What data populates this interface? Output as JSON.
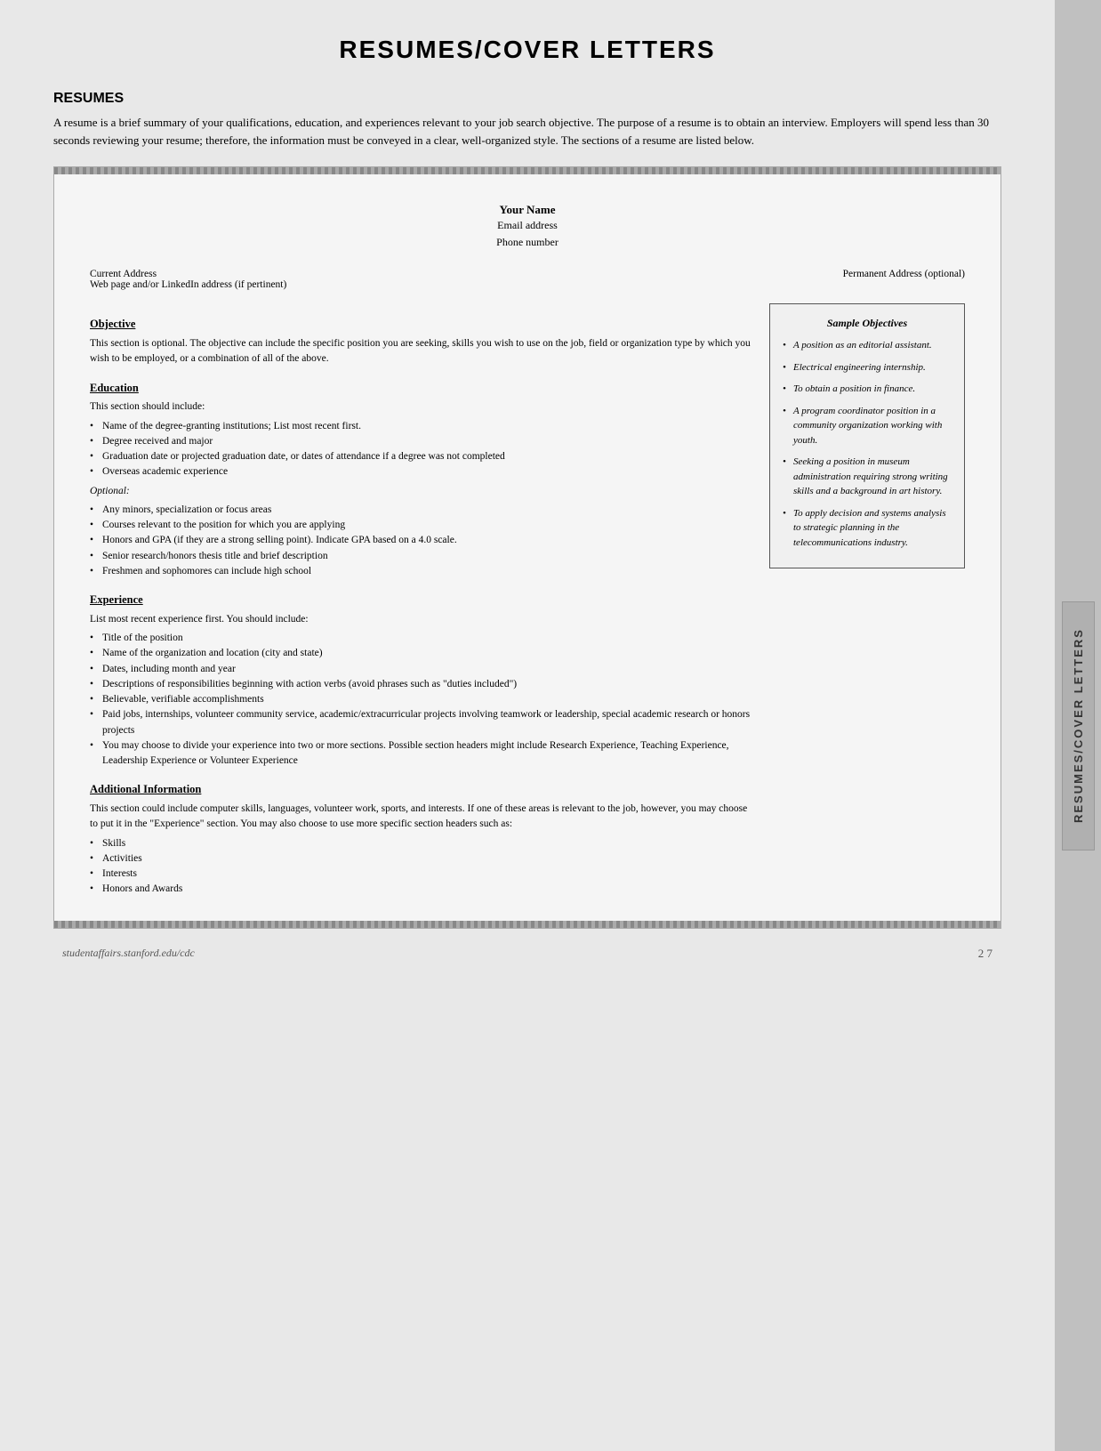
{
  "page": {
    "title": "RESUMES/COVER LETTERS",
    "side_tab_label": "RESUMES/COVER LETTERS",
    "footer_url": "studentaffairs.stanford.edu/cdc",
    "footer_page": "2 7"
  },
  "resumes_section": {
    "heading": "RESUMES",
    "intro": "A resume is a brief summary of your qualifications, education, and experiences relevant to your job search objective. The purpose of a resume is to obtain an interview. Employers will spend less than 30 seconds reviewing your resume; therefore, the information must be conveyed in a clear, well-organized style. The sections of a resume are listed below."
  },
  "resume_template": {
    "name": "Your Name",
    "email": "Email address",
    "phone": "Phone number",
    "current_address": "Current Address",
    "web_address": "Web page and/or LinkedIn address (if pertinent)",
    "permanent_address": "Permanent Address (optional)"
  },
  "objective_section": {
    "title": "Objective",
    "text": "This section is optional. The objective can include the specific position you are seeking, skills you wish to use on the job, field or organization type by which you wish to be employed, or a combination of all of the above."
  },
  "education_section": {
    "title": "Education",
    "intro": "This section should include:",
    "required_items": [
      "Name of the degree-granting institutions; List most recent first.",
      "Degree received and major",
      "Graduation date or projected graduation date, or dates of attendance if a degree was not completed",
      "Overseas academic experience"
    ],
    "optional_label": "Optional:",
    "optional_items": [
      "Any minors, specialization or focus areas",
      "Courses relevant to the position for which you are applying",
      "Honors and GPA (if they are a strong selling point). Indicate GPA based on a 4.0 scale.",
      "Senior research/honors thesis title and brief description",
      "Freshmen and sophomores can include high school"
    ]
  },
  "experience_section": {
    "title": "Experience",
    "intro": "List most recent experience first. You should include:",
    "items": [
      "Title of the position",
      "Name of the organization and location (city and state)",
      "Dates, including month and year",
      "Descriptions of responsibilities beginning with action verbs (avoid phrases such as \"duties included\")",
      "Believable, verifiable accomplishments",
      "Paid jobs, internships, volunteer community service, academic/extracurricular projects involving teamwork or leadership, special academic research or honors projects",
      "You may choose to divide your experience into two or more sections. Possible section headers might include Research Experience, Teaching Experience, Leadership Experience or Volunteer Experience"
    ]
  },
  "additional_info_section": {
    "title": "Additional Information",
    "text": "This section could include computer skills, languages, volunteer work, sports, and interests. If one of these areas is relevant to the job, however, you may choose to put it in the \"Experience\" section. You may also choose to use more specific section headers such as:",
    "items": [
      "Skills",
      "Activities",
      "Interests",
      "Honors and Awards"
    ]
  },
  "sample_objectives": {
    "box_title": "Sample Objectives",
    "items": [
      "A position as an editorial assistant.",
      "Electrical engineering internship.",
      "To obtain a position in finance.",
      "A program coordinator position in a community organization working with youth.",
      "Seeking a position in museum administration requiring strong writing skills and a background in art history.",
      "To apply decision and systems analysis to strategic planning in the telecommunications industry."
    ]
  }
}
